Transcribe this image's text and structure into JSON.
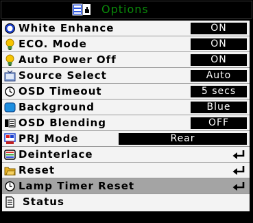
{
  "menu": {
    "title": "Options",
    "items": [
      {
        "label": "White Enhance",
        "value": "ON"
      },
      {
        "label": "ECO. Mode",
        "value": "ON"
      },
      {
        "label": "Auto Power Off",
        "value": "ON"
      },
      {
        "label": "Source Select",
        "value": "Auto"
      },
      {
        "label": "OSD Timeout",
        "value": "5 secs"
      },
      {
        "label": "Background",
        "value": "Blue"
      },
      {
        "label": "OSD Blending",
        "value": "OFF"
      },
      {
        "label": "PRJ Mode",
        "value": "Rear"
      },
      {
        "label": "Deinterlace"
      },
      {
        "label": "Reset"
      },
      {
        "label": "Lamp Timer Reset"
      },
      {
        "label": "Status"
      }
    ]
  },
  "colors": {
    "title_text": "#0a8a0a",
    "row_bg": "#f3f3f3",
    "selected_row_bg": "#a4a4a4",
    "value_bg": "#000000",
    "value_text": "#ffffff"
  },
  "icons": {
    "title": "options-monitor-icon",
    "white_enhance": "white-enhance-icon",
    "eco_mode": "lightbulb-icon",
    "auto_power_off": "lightbulb-icon",
    "source_select": "source-select-icon",
    "osd_timeout": "clock-icon",
    "background": "background-color-icon",
    "osd_blending": "osd-blending-icon",
    "prj_mode": "projector-mode-icon",
    "deinterlace": "deinterlace-icon",
    "reset": "folder-reset-icon",
    "lamp_timer_reset": "lamp-timer-icon",
    "status": "status-document-icon",
    "enter": "enter-arrow-icon"
  },
  "selected_item": "Lamp Timer Reset"
}
